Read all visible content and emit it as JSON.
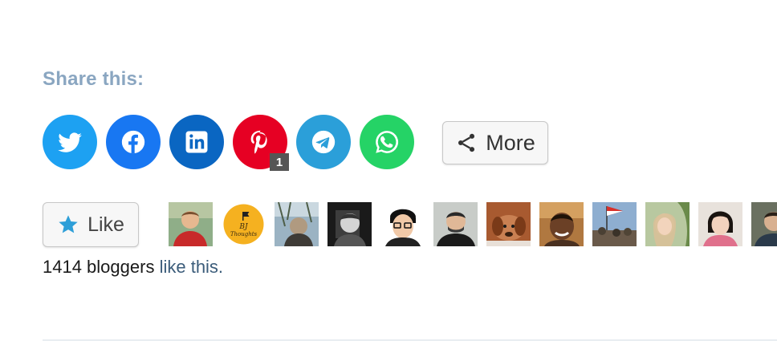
{
  "share": {
    "heading": "Share this:",
    "buttons": [
      {
        "id": "twitter",
        "icon": "twitter-icon",
        "color": "#1da1f2"
      },
      {
        "id": "facebook",
        "icon": "facebook-icon",
        "color": "#1877f2"
      },
      {
        "id": "linkedin",
        "icon": "linkedin-icon",
        "color": "#0a66c2"
      },
      {
        "id": "pinterest",
        "icon": "pinterest-icon",
        "color": "#e60023",
        "badge": "1"
      },
      {
        "id": "telegram",
        "icon": "telegram-icon",
        "color": "#2b9fd9"
      },
      {
        "id": "whatsapp",
        "icon": "whatsapp-icon",
        "color": "#25d366"
      }
    ],
    "more_label": "More",
    "more_icon": "share-icon"
  },
  "likes": {
    "like_label": "Like",
    "like_icon": "star-icon",
    "like_icon_color": "#2e9fd8",
    "count_text": "1414 bloggers",
    "link_text": "like this.",
    "avatar_count": 12
  }
}
